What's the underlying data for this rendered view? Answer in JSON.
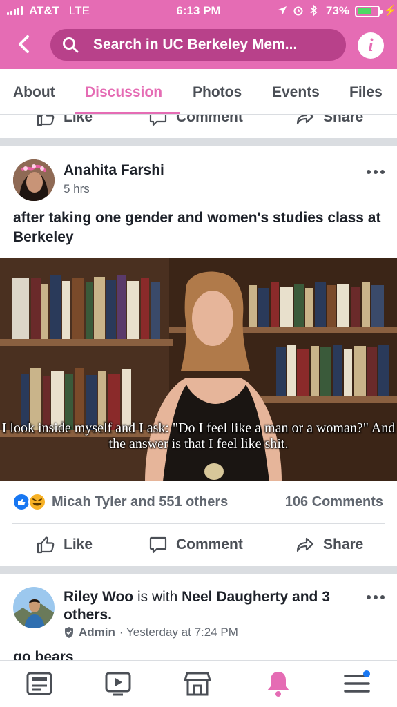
{
  "status": {
    "carrier": "AT&T",
    "network": "LTE",
    "time": "6:13 PM",
    "battery": "73%",
    "battery_level": 0.73
  },
  "header": {
    "back_icon": "chevron-left-icon",
    "search_placeholder": "Search in UC Berkeley Mem...",
    "info_icon": "info-icon",
    "info_glyph": "i"
  },
  "tabs": [
    {
      "label": "About",
      "active": false
    },
    {
      "label": "Discussion",
      "active": true
    },
    {
      "label": "Photos",
      "active": false
    },
    {
      "label": "Events",
      "active": false
    },
    {
      "label": "Files",
      "active": false
    }
  ],
  "actions": {
    "like": "Like",
    "comment": "Comment",
    "share": "Share"
  },
  "post1": {
    "author": "Anahita Farshi",
    "time": "5 hrs",
    "text": "after taking one gender and women's studies class at Berkeley",
    "caption": "I look inside myself and I ask: \"Do I feel like a man or a woman?\" And the answer is that I feel like shit.",
    "reactions": "Micah Tyler and 551 others",
    "comments": "106 Comments"
  },
  "post2": {
    "author": "Riley Woo",
    "with_text": " is with ",
    "tagged": "Neel Daugherty",
    "and_text": " and 3 others.",
    "admin": "Admin",
    "time": "· Yesterday at 7:24 PM",
    "text": "go bears"
  },
  "bottom_nav": [
    "news-feed-icon",
    "video-icon",
    "marketplace-icon",
    "notifications-icon",
    "menu-icon"
  ],
  "colors": {
    "accent": "#e56cb4",
    "search_bg": "#b8418a",
    "like_blue": "#1877f2",
    "text": "#1d2129",
    "muted": "#616770"
  }
}
